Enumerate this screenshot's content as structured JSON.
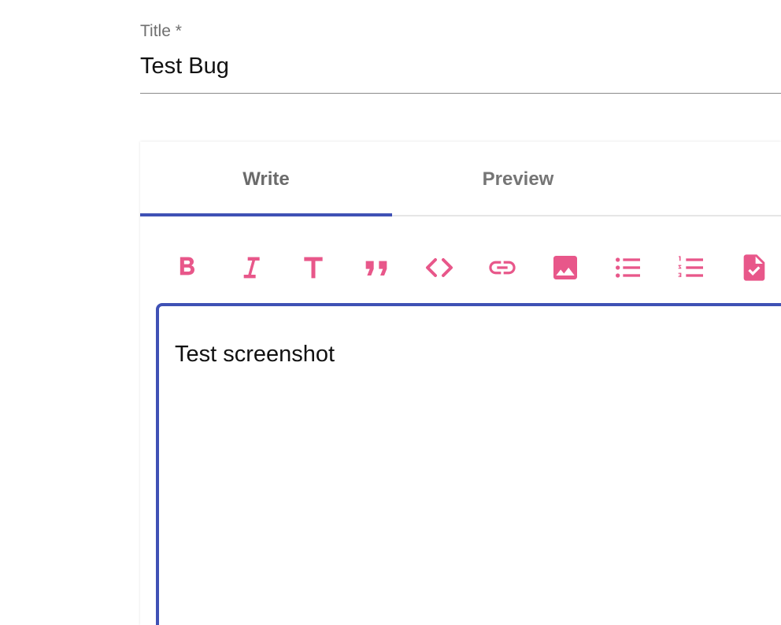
{
  "title_field": {
    "label": "Title *",
    "value": "Test Bug"
  },
  "editor": {
    "tabs": [
      {
        "label": "Write",
        "active": true
      },
      {
        "label": "Preview",
        "active": false
      }
    ],
    "toolbar": [
      {
        "icon": "bold-icon"
      },
      {
        "icon": "italic-icon"
      },
      {
        "icon": "header-icon"
      },
      {
        "icon": "quote-icon"
      },
      {
        "icon": "code-icon"
      },
      {
        "icon": "link-icon"
      },
      {
        "icon": "image-icon"
      },
      {
        "icon": "unordered-list-icon"
      },
      {
        "icon": "ordered-list-icon"
      },
      {
        "icon": "checked-list-icon"
      }
    ],
    "content": "Test screenshot"
  },
  "colors": {
    "accent": "#3f51b5",
    "icon": "#e8578a"
  }
}
